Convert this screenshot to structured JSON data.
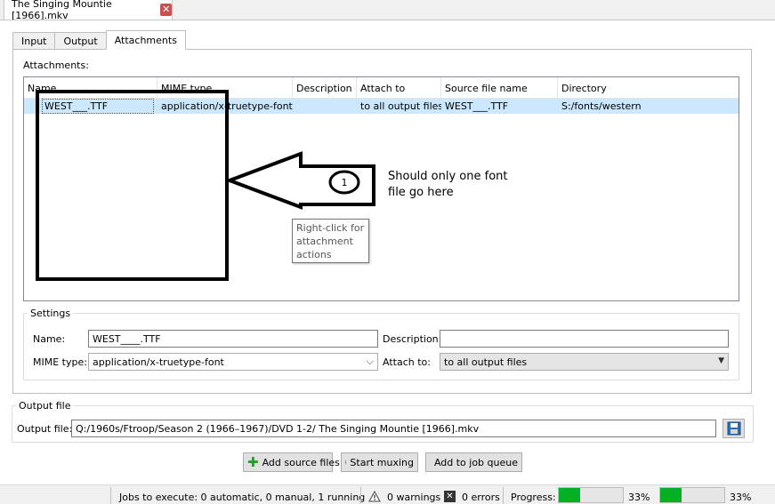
{
  "document_tab": {
    "title": "The Singing Mountie [1966].mkv"
  },
  "tabs": [
    {
      "label": "Input"
    },
    {
      "label": "Output"
    },
    {
      "label": "Attachments"
    }
  ],
  "attachments": {
    "label": "Attachments:",
    "columns": [
      "Name",
      "MIME type",
      "Description",
      "Attach to",
      "Source file name",
      "Directory"
    ],
    "rows": [
      {
        "name": "WEST___.TTF",
        "mime": "application/x-truetype-font",
        "description": "",
        "attach_to": "to all output files",
        "source_file": "WEST___.TTF",
        "directory": "S:/fonts/western"
      }
    ]
  },
  "annotation": {
    "number": "1",
    "text_line1": "Should only one font",
    "text_line2": "file go  here"
  },
  "tooltip": {
    "line1": "Right-click for",
    "line2": "attachment",
    "line3": "actions"
  },
  "settings": {
    "title": "Settings",
    "name_label": "Name:",
    "name_value": "WEST____.TTF",
    "description_label": "Description:",
    "description_value": "",
    "mime_label": "MIME type:",
    "mime_value": "application/x-truetype-font",
    "attach_label": "Attach to:",
    "attach_value": "to all output files"
  },
  "output": {
    "title": "Output file",
    "label": "Output file:",
    "value": "Q:/1960s/Ftroop/Season 2 (1966–1967)/DVD 1-2/ The Singing Mountie [1966].mkv"
  },
  "buttons": {
    "add_source": "Add source files",
    "start_muxing": "Start muxing",
    "add_queue": "Add to job queue"
  },
  "status": {
    "jobs": "Jobs to execute:  0 automatic, 0 manual, 1 running",
    "warnings": "0 warnings",
    "errors": "0 errors",
    "progress_label": "Progress:",
    "progress1_text": "33%",
    "progress1_value": 0.33,
    "progress2_text": "33%",
    "progress2_value": 0.33
  },
  "colors": {
    "selection": "#cce8ff",
    "progress_fill": "#06b025",
    "close_button": "#c75050"
  }
}
